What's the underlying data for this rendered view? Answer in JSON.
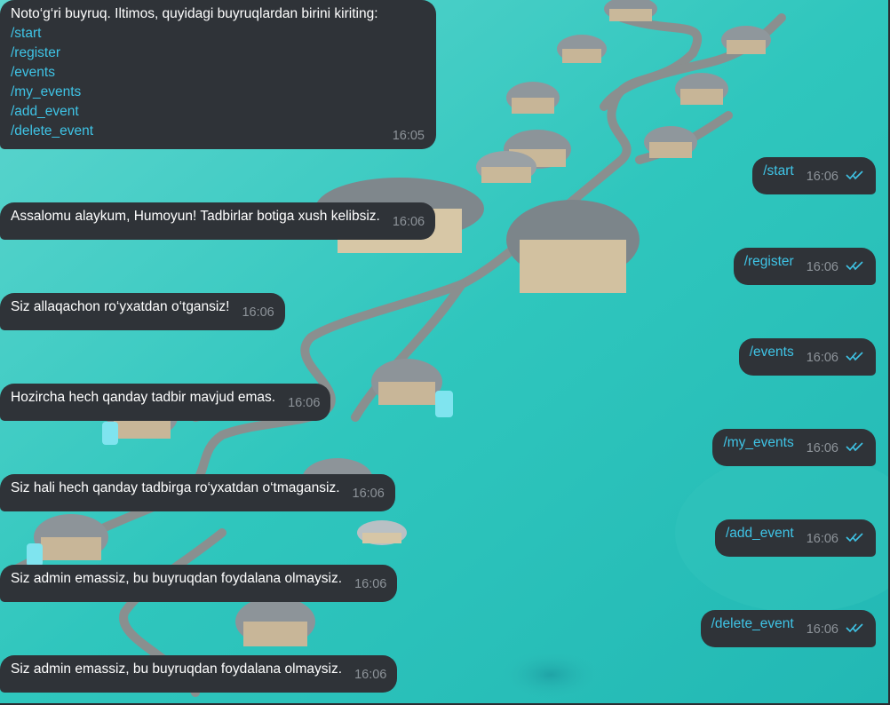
{
  "chat": {
    "incoming": [
      {
        "text": "Noto‘g‘ri buyruq. Iltimos, quyidagi buyruqlardan birini kiriting:",
        "commands": [
          "/start",
          "/register",
          "/events",
          "/my_events",
          "/add_event",
          "/delete_event"
        ],
        "time": "16:05"
      },
      {
        "text": "Assalomu alaykum, Humoyun! Tadbirlar botiga xush kelibsiz.",
        "time": "16:06"
      },
      {
        "text": "Siz allaqachon ro‘yxatdan o‘tgansiz!",
        "time": "16:06"
      },
      {
        "text": "Hozircha hech qanday tadbir mavjud emas.",
        "time": "16:06"
      },
      {
        "text": "Siz hali hech qanday tadbirga ro‘yxatdan o‘tmagansiz.",
        "time": "16:06"
      },
      {
        "text": "Siz admin emassiz, bu buyruqdan foydalana olmaysiz.",
        "time": "16:06"
      },
      {
        "text": "Siz admin emassiz, bu buyruqdan foydalana olmaysiz.",
        "time": "16:06"
      }
    ],
    "outgoing": [
      {
        "text": "/start",
        "time": "16:06",
        "status": "read-double-check-icon"
      },
      {
        "text": "/register",
        "time": "16:06",
        "status": "read-double-check-icon"
      },
      {
        "text": "/events",
        "time": "16:06",
        "status": "read-double-check-icon"
      },
      {
        "text": "/my_events",
        "time": "16:06",
        "status": "read-double-check-icon"
      },
      {
        "text": "/add_event",
        "time": "16:06",
        "status": "read-double-check-icon"
      },
      {
        "text": "/delete_event",
        "time": "16:06",
        "status": "read-double-check-icon"
      }
    ]
  },
  "colors": {
    "bubble": "#2f3338",
    "link": "#3fc4e6",
    "time": "#8d9399",
    "water": "#34c9c0"
  },
  "background": {
    "icon": "overwater-villas-wallpaper"
  }
}
